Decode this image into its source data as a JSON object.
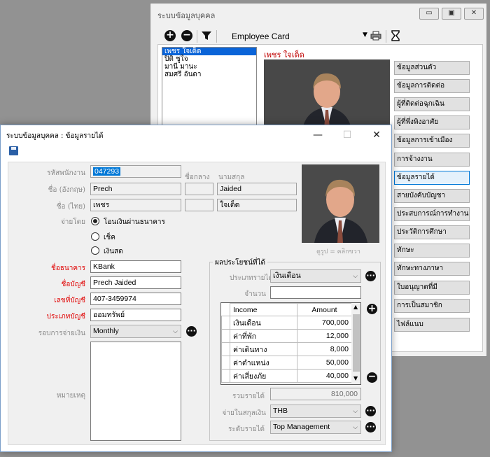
{
  "back_window": {
    "title": "ระบบข้อมูลบุคคล",
    "controls": [
      "▭",
      "▣",
      "✕"
    ],
    "toolbar": {
      "card_label": "Employee Card"
    },
    "employee_list": [
      "เพชร ใจเด็ด",
      "ปิติ ชูใจ",
      "มานี มานะ",
      "สมศรี อันดา"
    ],
    "selected_name": "เพชร ใจเด็ด",
    "side_buttons": [
      "ข้อมูลส่วนตัว",
      "ข้อมูลการติดต่อ",
      "ผู้ที่ติดต่อฉุกเฉิน",
      "ผู้ที่พึ่งพิงอาศัย",
      "ข้อมูลการเข้าเมือง",
      "การจ้างงาน",
      "ข้อมูลรายได้",
      "สายบังคับบัญชา",
      "ประสบการณ์การทำงาน",
      "ประวัติการศึกษา",
      "ทักษะ",
      "ทักษะทางภาษา",
      "ใบอนุญาตที่มี",
      "การเป็นสมาชิก",
      "ไฟล์แนบ"
    ],
    "active_button": "ข้อมูลรายได้"
  },
  "front_window": {
    "title": "ระบบข้อมูลบุคคล : ข้อมูลรายได้",
    "controls": {
      "minimize": "—",
      "maximize": "☐",
      "close": "✕"
    },
    "labels": {
      "employee_id": "รหัสพนักงาน",
      "middle_name": "ชื่อกลาง",
      "surname": "นามสกุล",
      "name_en": "ชื่อ (อังกฤษ)",
      "name_th": "ชื่อ (ไทย)",
      "payment_by": "จ่ายโดย",
      "bank_name": "ชื่อธนาคาร",
      "account_name": "ชื่อบัญชี",
      "account_no": "เลขที่บัญชี",
      "account_type": "ประเภทบัญชี",
      "pay_period": "รอบการจ่ายเงิน",
      "remark": "หมายเหตุ",
      "photo_caption": "ดูรูป = คลิกขวา"
    },
    "values": {
      "employee_id": "047293",
      "first_en": "Prech",
      "middle_en": "",
      "last_en": "Jaided",
      "first_th": "เพชร",
      "middle_th": "",
      "last_th": "ใจเด็ด",
      "bank_name": "KBank",
      "account_name": "Prech Jaided",
      "account_no": "407-3459974",
      "account_type": "ออมทรัพย์",
      "pay_period": "Monthly"
    },
    "payment_options": [
      {
        "label": "โอนเงินผ่านธนาคาร",
        "selected": true
      },
      {
        "label": "เช็ค",
        "selected": false
      },
      {
        "label": "เงินสด",
        "selected": false
      }
    ],
    "benefits": {
      "group_title": "ผลประโยชน์ที่ได้",
      "income_type_label": "ประเภทรายได้",
      "income_type_value": "เงินเดือน",
      "amount_label": "จำนวน",
      "amount_value": "",
      "table_headers": [
        "Income",
        "Amount"
      ],
      "rows": [
        {
          "income": "เงินเดือน",
          "amount": "700,000"
        },
        {
          "income": "ค่าที่พัก",
          "amount": "12,000"
        },
        {
          "income": "ค่าเดินทาง",
          "amount": "8,000"
        },
        {
          "income": "ค่าตำแหน่ง",
          "amount": "50,000"
        },
        {
          "income": "ค่าเสี่ยงภัย",
          "amount": "40,000"
        }
      ],
      "total_label": "รวมรายได้",
      "total_value": "810,000",
      "currency_label": "จ่ายในสกุลเงิน",
      "currency_value": "THB",
      "income_level_label": "ระดับรายได้",
      "income_level_value": "Top Management"
    }
  }
}
